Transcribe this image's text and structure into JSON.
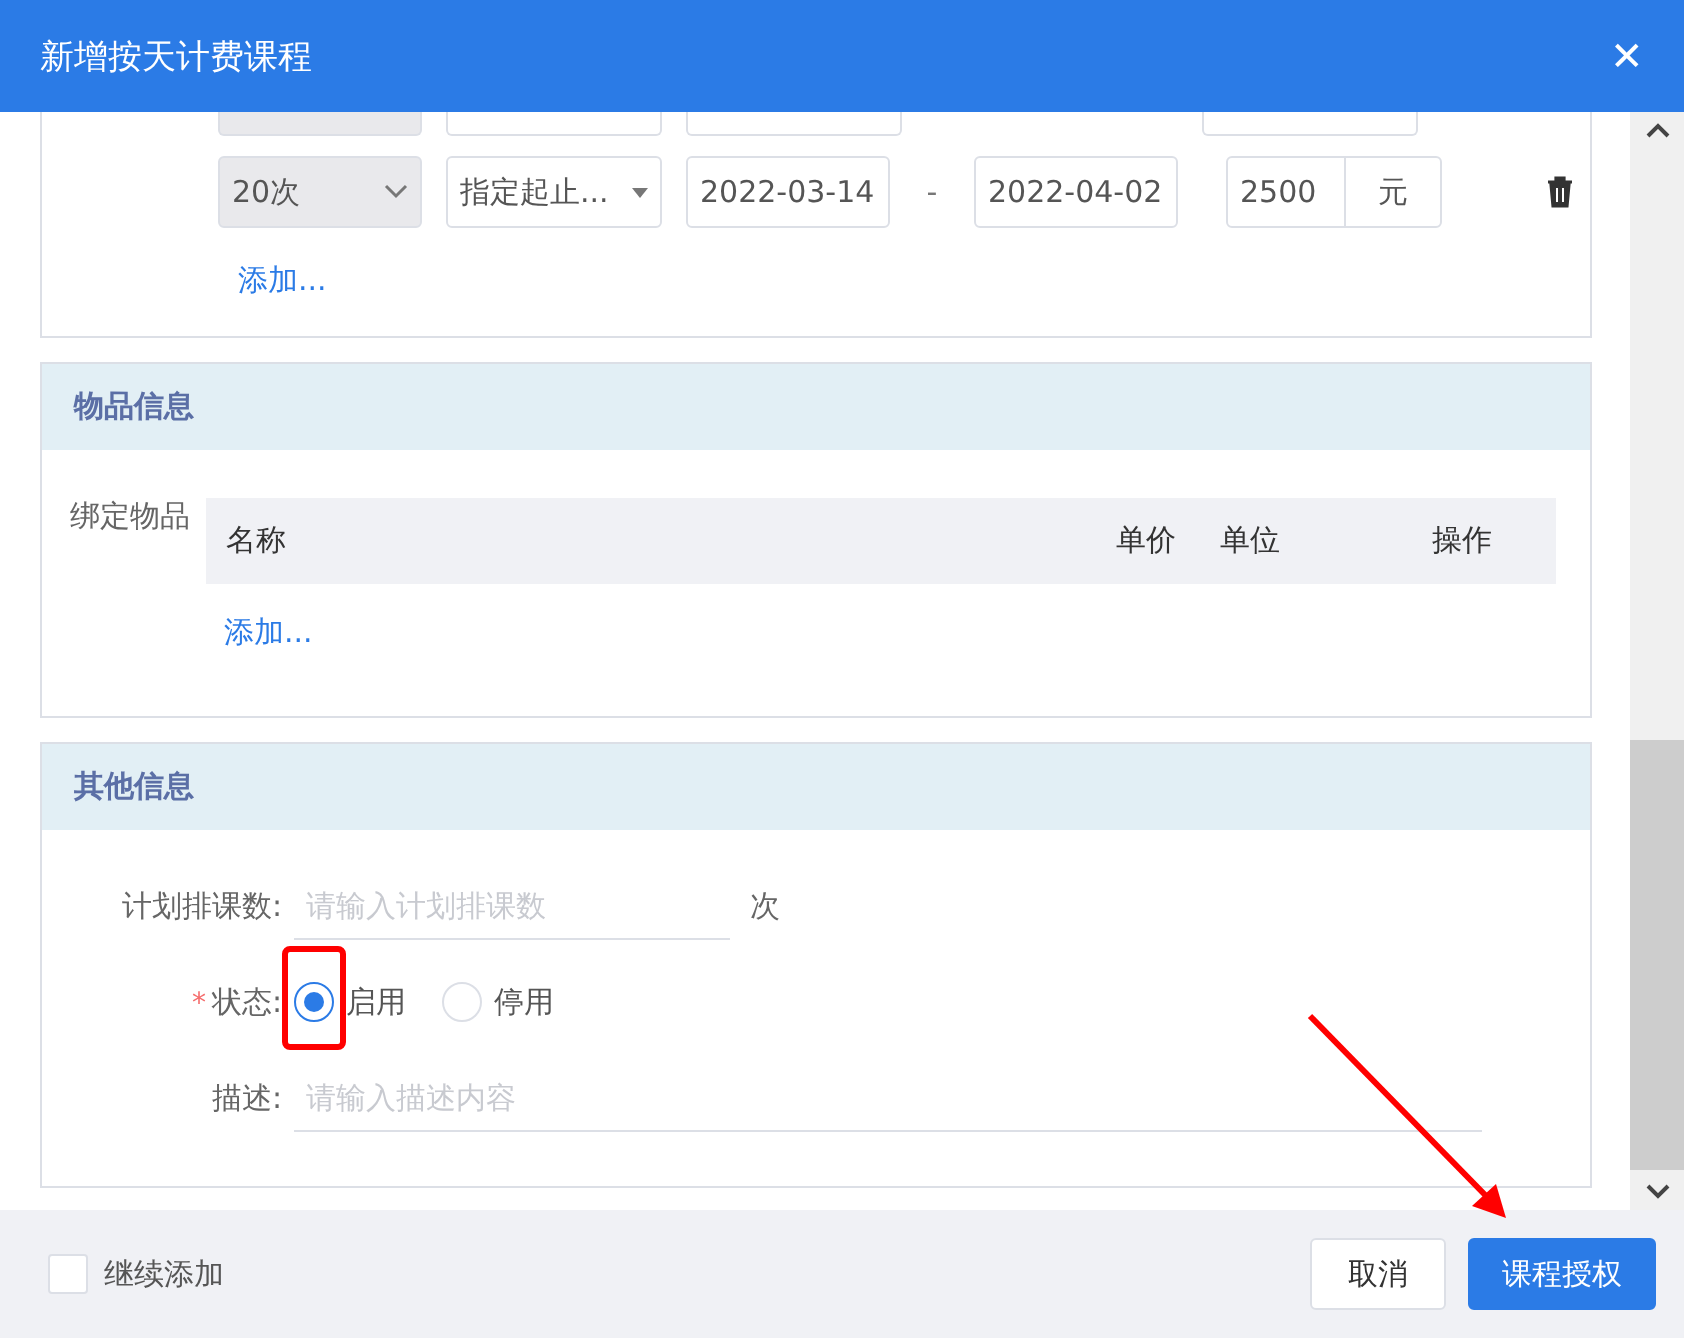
{
  "dialog": {
    "title": "新增按天计费课程",
    "close": "✕"
  },
  "pricing": {
    "rows": [
      {
        "count": "20次",
        "mode": "指定起止...",
        "start": "2022-03-14",
        "separator": "-",
        "end": "2022-04-02",
        "amount": "2500",
        "unit": "元"
      }
    ],
    "add": "添加..."
  },
  "goods": {
    "title": "物品信息",
    "label": "绑定物品",
    "columns": [
      "名称",
      "单价",
      "单位",
      "操作"
    ],
    "add": "添加..."
  },
  "other": {
    "title": "其他信息",
    "plan": {
      "label": "计划排课数:",
      "placeholder": "请输入计划排课数",
      "suffix": "次"
    },
    "status": {
      "required": "*",
      "label": "状态:",
      "options": [
        {
          "label": "启用",
          "selected": true
        },
        {
          "label": "停用",
          "selected": false
        }
      ]
    },
    "desc": {
      "label": "描述:",
      "placeholder": "请输入描述内容"
    }
  },
  "footer": {
    "continue": {
      "label": "继续添加",
      "checked": false
    },
    "buttons": [
      {
        "label": "取消",
        "kind": "secondary"
      },
      {
        "label": "课程授权",
        "kind": "primary"
      }
    ]
  }
}
